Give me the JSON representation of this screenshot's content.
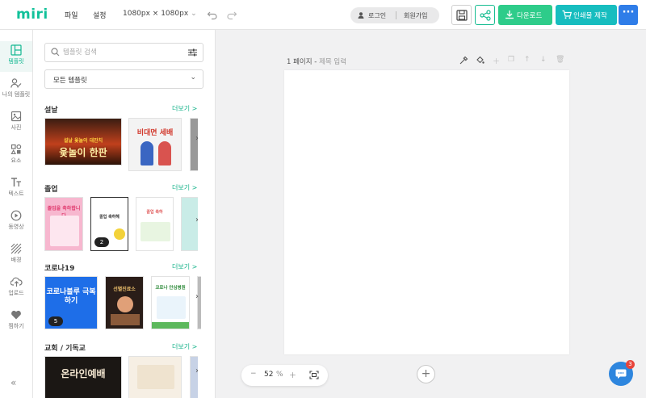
{
  "header": {
    "logo": "miri",
    "menu": [
      "파일",
      "설정"
    ],
    "size": "1080px × 1080px",
    "auth": {
      "login": "로그인",
      "signup": "회원가입"
    },
    "download_label": "다운로드",
    "print_label": "인쇄물 제작",
    "more_label": "···",
    "accent": "#12c19a"
  },
  "rail": {
    "items": [
      {
        "label": "템플릿",
        "icon": "template-icon",
        "active": true
      },
      {
        "label": "나의 템플릿",
        "icon": "my-template-icon"
      },
      {
        "label": "사진",
        "icon": "photo-icon"
      },
      {
        "label": "요소",
        "icon": "elements-icon"
      },
      {
        "label": "텍스트",
        "icon": "text-icon"
      },
      {
        "label": "동영상",
        "icon": "video-icon"
      },
      {
        "label": "배경",
        "icon": "background-icon"
      },
      {
        "label": "업로드",
        "icon": "upload-icon"
      },
      {
        "label": "찜하기",
        "icon": "heart-icon"
      }
    ],
    "collapse": "«"
  },
  "panel": {
    "search_placeholder": "템플릿 검색",
    "filter": "모든 템플릿",
    "more_label": "더보기 >",
    "sections": [
      {
        "title": "설날",
        "thumbs": [
          "설날 윷놀이 대잔치",
          "윷놀이 한판",
          "비대면 세배"
        ]
      },
      {
        "title": "졸업",
        "thumbs": [
          "졸업을 축하합니다",
          "졸업 축하해",
          "졸업 축하"
        ],
        "badge": "2"
      },
      {
        "title": "코로나19",
        "thumbs": [
          "코로나블루 극복하기",
          "선별진료소",
          "코로나 안심병원"
        ],
        "badge": "5"
      },
      {
        "title": "교회 / 기독교",
        "thumbs": [
          "온라인예배"
        ]
      }
    ]
  },
  "canvas": {
    "page_number": "1 페이지",
    "page_title_placeholder": "제목 입력",
    "zoom_value": "52",
    "zoom_unit": "%",
    "add_page": "+"
  },
  "chat": {
    "badge": "3"
  }
}
